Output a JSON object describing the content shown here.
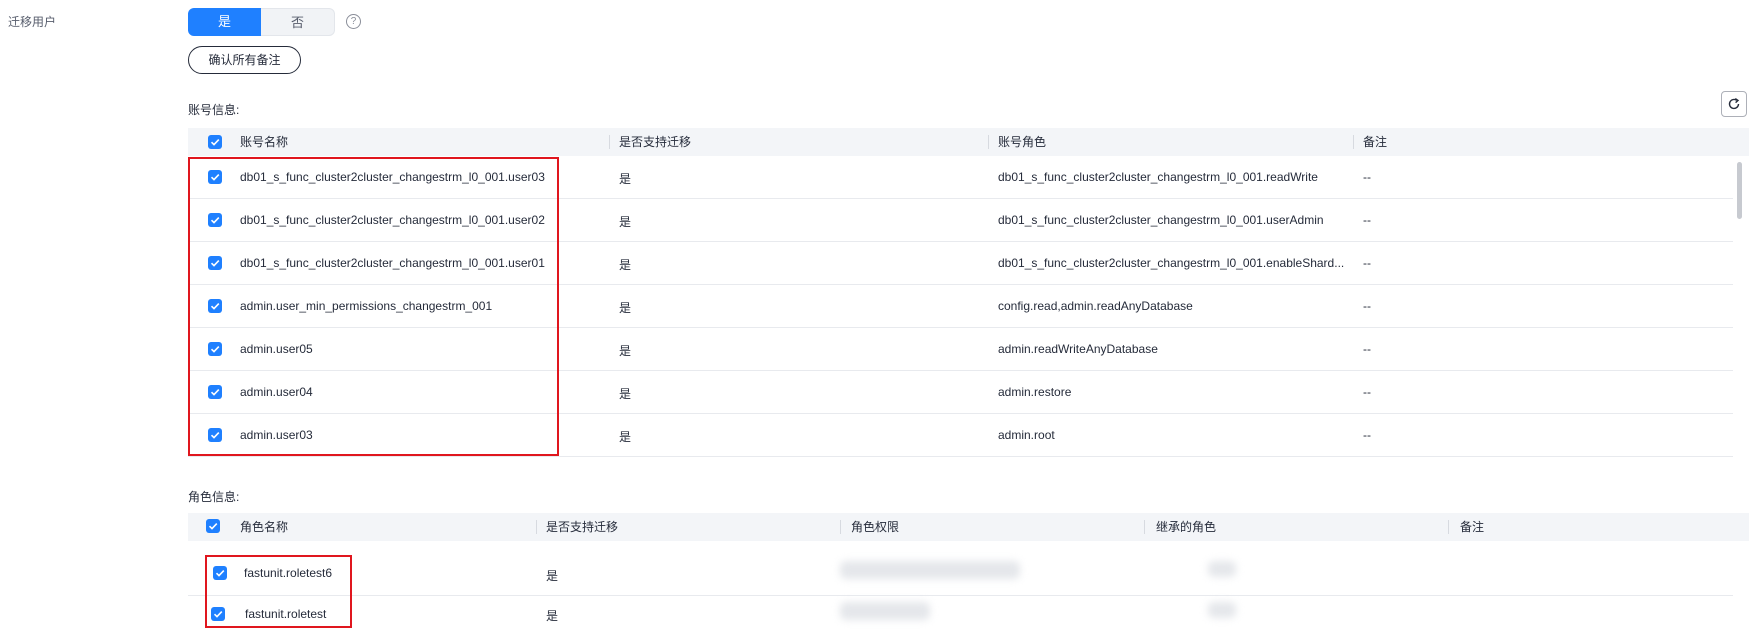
{
  "migrate_user": {
    "label": "迁移用户",
    "options": [
      "是",
      "否"
    ],
    "selected": "是",
    "help_icon": "question-circle-icon"
  },
  "confirm_all_remarks_label": "确认所有备注",
  "accounts": {
    "title": "账号信息:",
    "refresh_icon": "refresh-icon",
    "columns": [
      "账号名称",
      "是否支持迁移",
      "账号角色",
      "备注"
    ],
    "rows": [
      {
        "name": "db01_s_func_cluster2cluster_changestrm_l0_001.user03",
        "supported": "是",
        "role": "db01_s_func_cluster2cluster_changestrm_l0_001.readWrite",
        "remark": "--",
        "checked": true
      },
      {
        "name": "db01_s_func_cluster2cluster_changestrm_l0_001.user02",
        "supported": "是",
        "role": "db01_s_func_cluster2cluster_changestrm_l0_001.userAdmin",
        "remark": "--",
        "checked": true
      },
      {
        "name": "db01_s_func_cluster2cluster_changestrm_l0_001.user01",
        "supported": "是",
        "role": "db01_s_func_cluster2cluster_changestrm_l0_001.enableShard...",
        "remark": "--",
        "checked": true
      },
      {
        "name": "admin.user_min_permissions_changestrm_001",
        "supported": "是",
        "role": "config.read,admin.readAnyDatabase",
        "remark": "--",
        "checked": true
      },
      {
        "name": "admin.user05",
        "supported": "是",
        "role": "admin.readWriteAnyDatabase",
        "remark": "--",
        "checked": true
      },
      {
        "name": "admin.user04",
        "supported": "是",
        "role": "admin.restore",
        "remark": "--",
        "checked": true
      },
      {
        "name": "admin.user03",
        "supported": "是",
        "role": "admin.root",
        "remark": "--",
        "checked": true
      }
    ]
  },
  "roles": {
    "title": "角色信息:",
    "columns": [
      "角色名称",
      "是否支持迁移",
      "角色权限",
      "继承的角色",
      "备注"
    ],
    "rows": [
      {
        "name": "fastunit.roletest6",
        "supported": "是",
        "checked": true
      },
      {
        "name": "fastunit.roletest",
        "supported": "是",
        "checked": true
      }
    ]
  },
  "colors": {
    "accent": "#1f80ff",
    "highlight": "#e0161e"
  }
}
